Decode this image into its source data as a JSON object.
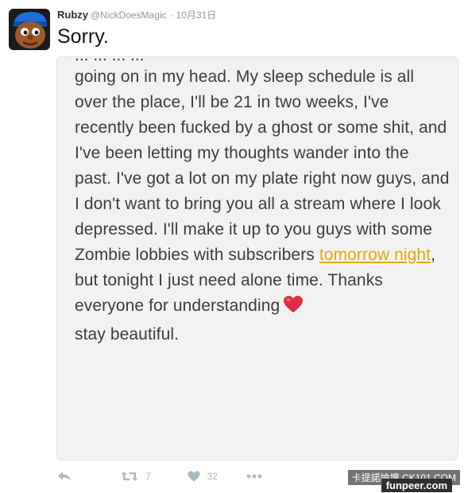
{
  "tweet": {
    "display_name": "Rubzy",
    "handle": "@NickDoesMagic",
    "separator": "·",
    "date": "10月31日",
    "text": "Sorry.",
    "avatar_icon": "cartoon-face-avatar"
  },
  "note": {
    "partial_top": "... ... ... ...",
    "before_link": "going on in my head. My sleep schedule is all over the place, I'll be 21 in two weeks, I've recently been fucked by a ghost or some shit, and I've been letting my thoughts wander into the past. I've got a lot on my plate right now guys, and I don't want to bring you all a stream where I look depressed. I'll make it up to you guys with some Zombie lobbies with subscribers ",
    "link_text": "tomorrow night",
    "after_link": ", but tonight I just need alone time. Thanks everyone for understanding",
    "ending": "stay beautiful.",
    "emoji_icon": "red-heart-emoji"
  },
  "actions": {
    "reply_icon": "reply-icon",
    "retweet_icon": "retweet-icon",
    "retweet_count": "7",
    "like_icon": "heart-icon",
    "like_count": "32",
    "more_icon": "more-icon"
  },
  "watermarks": {
    "line1": "卡提諾論壇 CK101.COM",
    "line2": "funpeer.com"
  },
  "colors": {
    "link": "#e0a800",
    "muted": "#aab8c2",
    "heart": "#e0245e"
  }
}
